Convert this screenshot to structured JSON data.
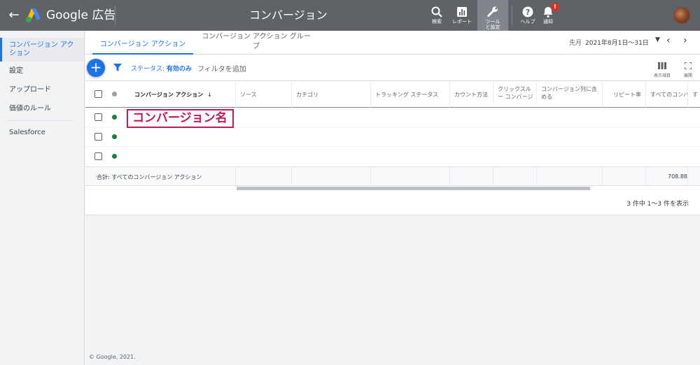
{
  "header": {
    "brand": "Google 広告",
    "title": "コンバージョン",
    "buttons": [
      {
        "icon": "search-icon",
        "label": "検索"
      },
      {
        "icon": "reports-icon",
        "label": "レポート"
      },
      {
        "icon": "wrench-icon",
        "label": "ツールと設定"
      },
      {
        "icon": "help-icon",
        "label": "ヘルプ"
      },
      {
        "icon": "bell-icon",
        "label": "通知"
      }
    ],
    "notification_badge": "!"
  },
  "sidebar": {
    "items": [
      {
        "label": "コンバージョン アクション",
        "active": true
      },
      {
        "label": "設定"
      },
      {
        "label": "アップロード"
      },
      {
        "label": "価値のルール"
      },
      {
        "label": "Salesforce"
      }
    ]
  },
  "tabs": [
    {
      "label": "コンバージョン アクション",
      "active": true
    },
    {
      "label": "コンバージョン アクション グループ"
    }
  ],
  "date_range": {
    "prefix": "先月",
    "value": "2021年8月1日〜31日"
  },
  "toolbar": {
    "add_label": "+",
    "status_prefix": "ステータス: ",
    "status_value": "有効のみ",
    "add_filter": "フィルタを追加",
    "columns_label": "表示項目",
    "expand_label": "展開"
  },
  "table": {
    "columns": [
      "コンバージョン アクション",
      "ソース",
      "カテゴリ",
      "トラッキング ステータス",
      "カウント方法",
      "クリックスルー コンバージョン",
      "コンバージョン列に含める",
      "リピート率",
      "すべてのコンバージョン",
      "す"
    ],
    "sort_indicator": "↓",
    "rows": [
      {
        "status": "active"
      },
      {
        "status": "active"
      },
      {
        "status": "active"
      }
    ],
    "total_label": "合計: すべてのコンバージョン アクション",
    "total_value": "708.88",
    "pagination": "3 件中 1〜3 件を表示"
  },
  "annotation": {
    "text": "コンバージョン名"
  },
  "footer": {
    "copyright": "© Google, 2021."
  },
  "colors": {
    "topbar": "#5f6368",
    "accent": "#1a73e8",
    "active_dot": "#188038",
    "annotation": "#c2185b"
  }
}
